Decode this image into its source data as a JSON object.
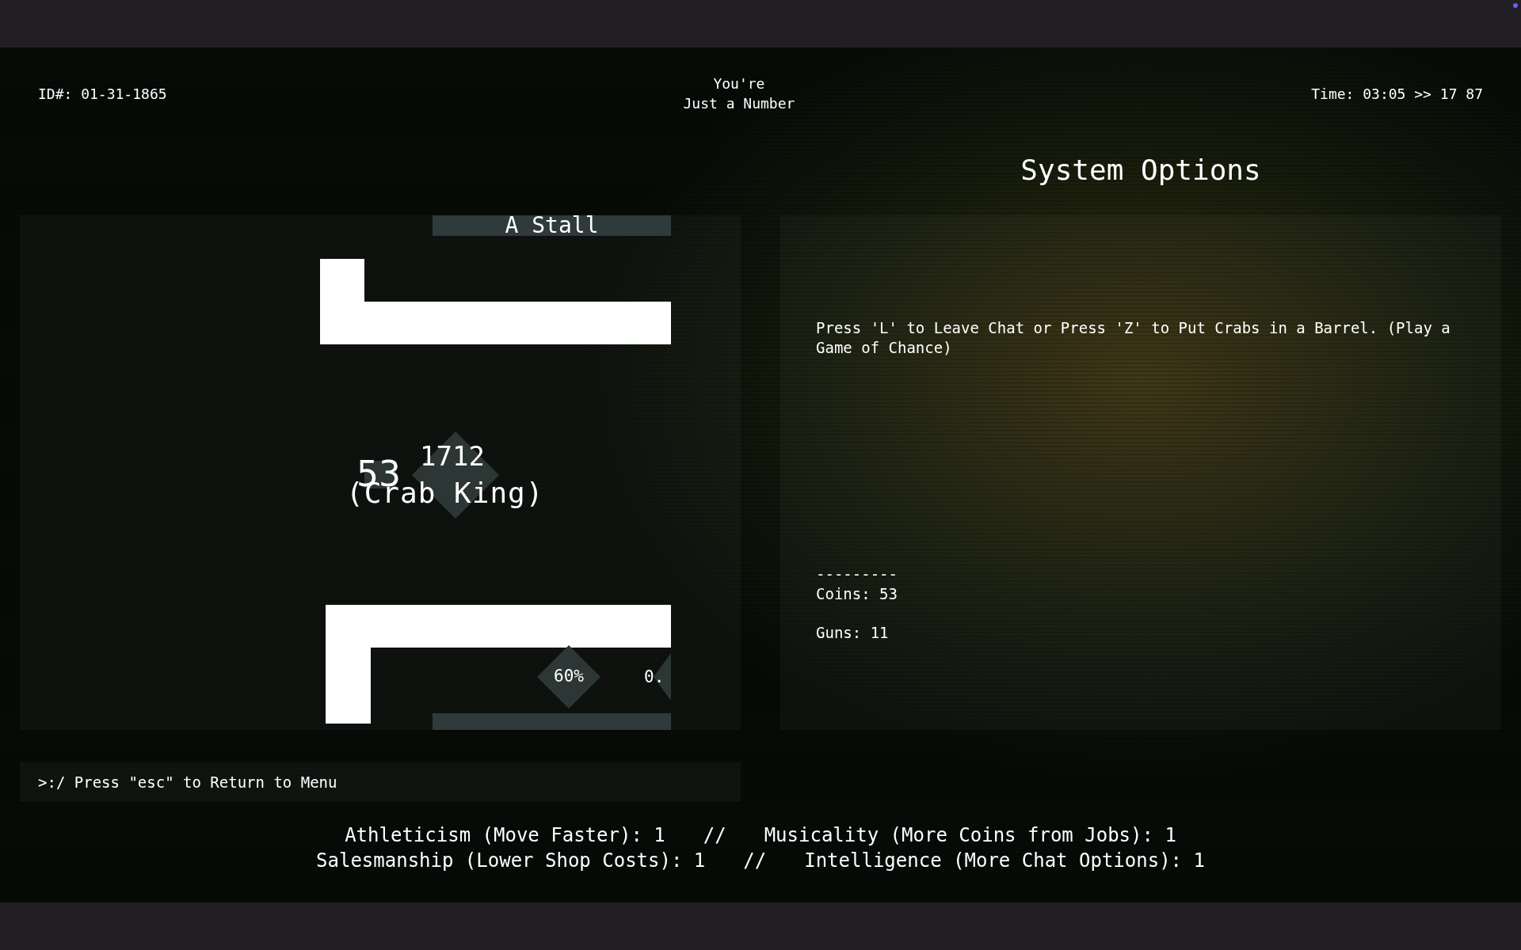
{
  "header": {
    "id_label": "ID#: 01-31-1865",
    "title_lines": [
      "You're",
      "Just a Number"
    ],
    "time": "Time: 03:05 >> 17 87"
  },
  "game_view": {
    "stall_label": "A Stall",
    "player": {
      "number": "1712",
      "coins_tag": "53",
      "name": "(Crab King)"
    },
    "chance_badge": "60%",
    "partial_badge": "0."
  },
  "system_options": {
    "title": "System Options",
    "message": "Press 'L' to Leave Chat or Press 'Z' to Put Crabs in a Barrel. (Play a Game of Chance)",
    "separator": "---------",
    "stats": [
      "Coins: 53",
      "Guns: 11"
    ]
  },
  "command_line": ">:/ Press \"esc\" to Return to Menu",
  "attributes": [
    {
      "left": "Athleticism (Move Faster): 1",
      "separator": "//",
      "right": "Musicality (More Coins from Jobs): 1"
    },
    {
      "left": "Salesmanship (Lower Shop Costs): 1",
      "separator": "//",
      "right": "Intelligence (More Chat Options): 1"
    }
  ]
}
